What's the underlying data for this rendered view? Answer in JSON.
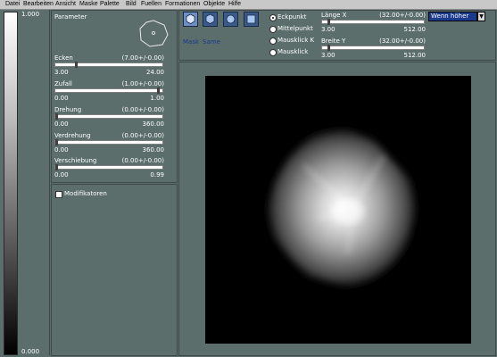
{
  "menu": [
    "Datei",
    "Bearbeiten",
    "Ansicht",
    "Maske",
    "Palette",
    "Bild",
    "Fuellen",
    "Formationen",
    "Objekte",
    "Hilfe"
  ],
  "gradient": {
    "top_label": "1.000",
    "bottom_label": "0.000"
  },
  "parameter": {
    "title": "Parameter",
    "sliders": [
      {
        "label": "Ecken",
        "value": "(7.00+/-0.00)",
        "min": "3.00",
        "max": "24.00",
        "pos": 0.19
      },
      {
        "label": "Zufall",
        "value": "(1.00+/-0.00)",
        "min": "0.00",
        "max": "1.00",
        "pos": 0.94
      },
      {
        "label": "Drehung",
        "value": "(0.00+/-0.00)",
        "min": "0.00",
        "max": "360.00",
        "pos": 0.0
      },
      {
        "label": "Verdrehung",
        "value": "(0.00+/-0.00)",
        "min": "0.00",
        "max": "360.00",
        "pos": 0.0
      },
      {
        "label": "Verschiebung",
        "value": "(0.00+/-0.00)",
        "min": "0.00",
        "max": "0.99",
        "pos": 0.0
      }
    ]
  },
  "modifikatoren": {
    "label": "Modifikatoren"
  },
  "toolbar": {
    "mask_label": "Mask",
    "same_label": "Same",
    "options": [
      "Eckpunkt",
      "Mittelpunkt",
      "Mausklick K",
      "Mausklick"
    ],
    "selected_option": 0,
    "laenge": {
      "label": "Länge X",
      "value": "(32.00+/-0.00)",
      "min": "3.00",
      "max": "512.00",
      "pos": 0.06
    },
    "breite": {
      "label": "Breite Y",
      "value": "(32.00+/-0.00)",
      "min": "3.00",
      "max": "512.00",
      "pos": 0.06
    },
    "dropdown_value": "Wenn höher"
  }
}
